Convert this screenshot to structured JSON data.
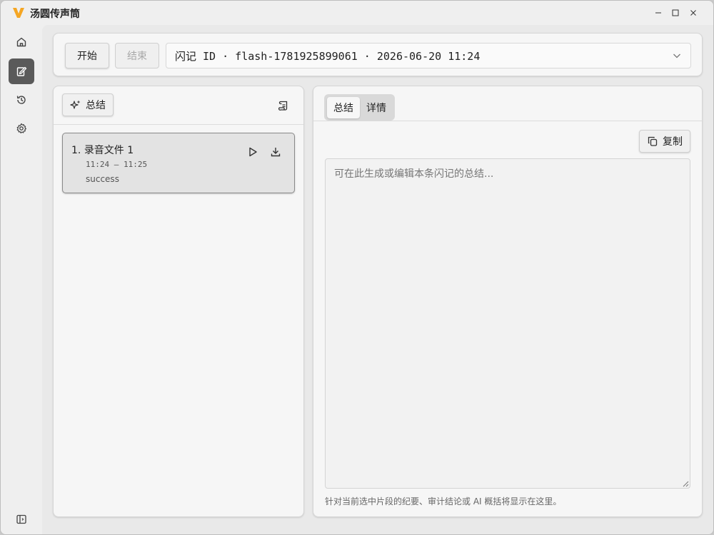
{
  "app": {
    "title": "汤圆传声筒",
    "brand_color": "#f5a623"
  },
  "window_controls": [
    "minimize-icon",
    "maximize-icon",
    "close-icon"
  ],
  "rail": {
    "items": [
      {
        "name": "home",
        "icon": "home-icon",
        "active": false
      },
      {
        "name": "notes",
        "icon": "edit-note-icon",
        "active": true
      },
      {
        "name": "history",
        "icon": "history-icon",
        "active": false
      },
      {
        "name": "settings",
        "icon": "gear-icon",
        "active": false
      }
    ],
    "bottom_icon": "sidebar-toggle-icon"
  },
  "toolbar": {
    "start_label": "开始",
    "end_label": "结束",
    "session_select": {
      "value": "闪记 ID · flash-1781925899061 · 2026-06-20 11:24"
    }
  },
  "left_panel": {
    "summary_button_label": "总结",
    "files": [
      {
        "index": "1.",
        "title": "录音文件 1",
        "time": "11:24 — 11:25",
        "status": "success"
      }
    ]
  },
  "right_panel": {
    "tabs": [
      {
        "label": "总结",
        "active": true
      },
      {
        "label": "详情",
        "active": false
      }
    ],
    "copy_label": "复制",
    "summary_placeholder": "可在此生成或编辑本条闪记的总结...",
    "hint": "针对当前选中片段的纪要、审计结论或 AI 概括将显示在这里。"
  }
}
